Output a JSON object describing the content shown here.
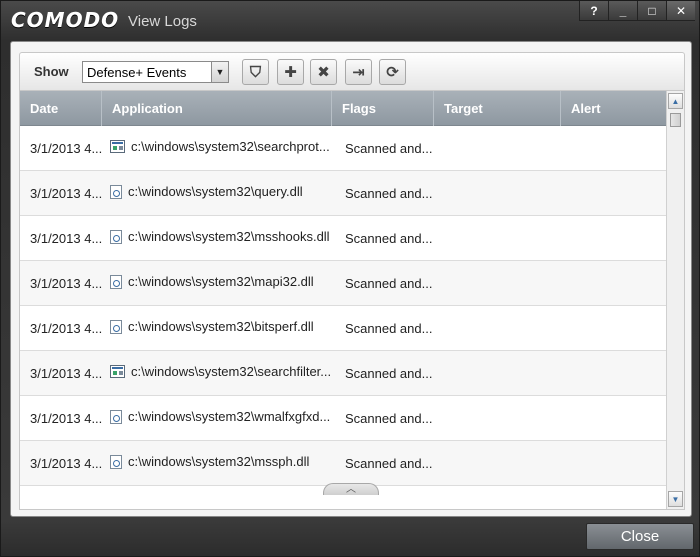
{
  "window": {
    "brand": "COMODO",
    "title": "View Logs",
    "controls": {
      "help": "?",
      "minimize": "_",
      "maximize": "□",
      "close": "✕"
    }
  },
  "toolbar": {
    "show_label": "Show",
    "filter_select": {
      "value": "Defense+ Events",
      "arrow": "▼"
    },
    "buttons": [
      {
        "name": "filter-button",
        "icon": "funnel-icon",
        "glyph": "⛉"
      },
      {
        "name": "add-button",
        "icon": "plus-icon",
        "glyph": "✚"
      },
      {
        "name": "delete-button",
        "icon": "x-icon",
        "glyph": "✖"
      },
      {
        "name": "export-button",
        "icon": "export-icon",
        "glyph": "⇥"
      },
      {
        "name": "refresh-button",
        "icon": "refresh-icon",
        "glyph": "⟳"
      }
    ]
  },
  "table": {
    "columns": [
      "Date",
      "Application",
      "Flags",
      "Target",
      "Alert"
    ],
    "rows": [
      {
        "date": "3/1/2013 4...",
        "icon": "exe",
        "application": "c:\\windows\\system32\\searchprot...",
        "flags": "Scanned and..."
      },
      {
        "date": "3/1/2013 4...",
        "icon": "dll",
        "application": "c:\\windows\\system32\\query.dll",
        "flags": "Scanned and..."
      },
      {
        "date": "3/1/2013 4...",
        "icon": "dll",
        "application": "c:\\windows\\system32\\msshooks.dll",
        "flags": "Scanned and..."
      },
      {
        "date": "3/1/2013 4...",
        "icon": "dll",
        "application": "c:\\windows\\system32\\mapi32.dll",
        "flags": "Scanned and..."
      },
      {
        "date": "3/1/2013 4...",
        "icon": "dll",
        "application": "c:\\windows\\system32\\bitsperf.dll",
        "flags": "Scanned and..."
      },
      {
        "date": "3/1/2013 4...",
        "icon": "exe",
        "application": "c:\\windows\\system32\\searchfilter...",
        "flags": "Scanned and..."
      },
      {
        "date": "3/1/2013 4...",
        "icon": "dll",
        "application": "c:\\windows\\system32\\wmalfxgfxd...",
        "flags": "Scanned and..."
      },
      {
        "date": "3/1/2013 4...",
        "icon": "dll",
        "application": "c:\\windows\\system32\\mssph.dll",
        "flags": "Scanned and..."
      }
    ]
  },
  "collapse_glyph": "︿",
  "footer": {
    "close_label": "Close"
  }
}
